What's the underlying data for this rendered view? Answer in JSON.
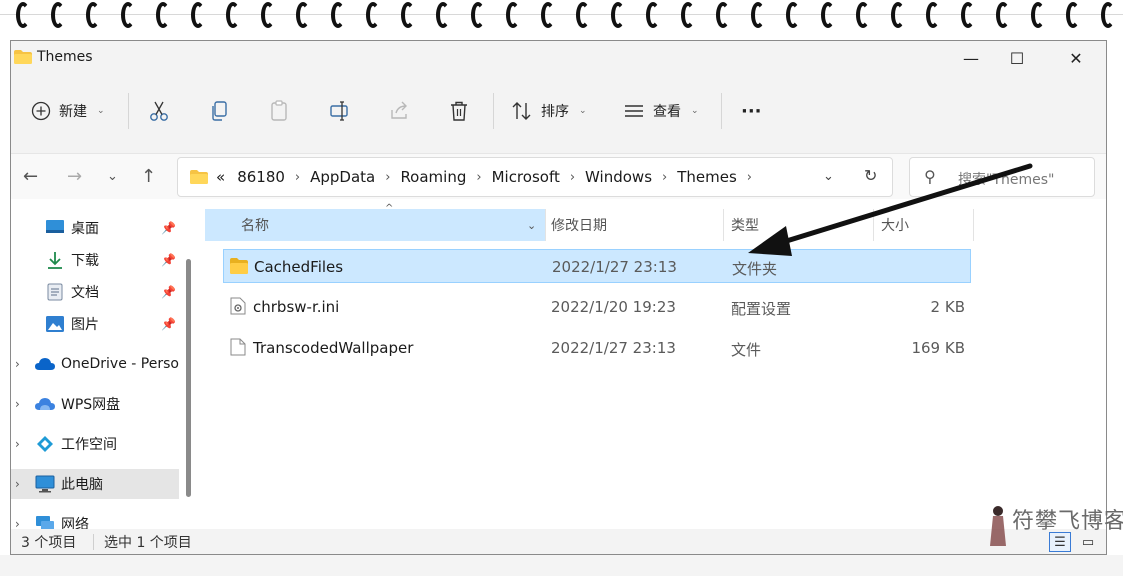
{
  "window": {
    "title": "Themes",
    "controls": {
      "minimize": "—",
      "maximize": "☐",
      "close": "✕"
    }
  },
  "toolbar": {
    "new_label": "新建",
    "sort_label": "排序",
    "view_label": "查看",
    "more_label": "···"
  },
  "address": {
    "overflow": "«",
    "crumbs": [
      "86180",
      "AppData",
      "Roaming",
      "Microsoft",
      "Windows",
      "Themes"
    ],
    "search_placeholder": "搜索\"Themes\""
  },
  "sidebar": {
    "quick": [
      {
        "label": "桌面",
        "icon": "desktop-icon"
      },
      {
        "label": "下载",
        "icon": "download-icon"
      },
      {
        "label": "文档",
        "icon": "document-icon"
      },
      {
        "label": "图片",
        "icon": "pictures-icon"
      }
    ],
    "groups": [
      {
        "label": "OneDrive - Personal",
        "icon": "onedrive-icon"
      },
      {
        "label": "WPS网盘",
        "icon": "wps-cloud-icon"
      },
      {
        "label": "工作空间",
        "icon": "workspace-icon"
      },
      {
        "label": "此电脑",
        "icon": "this-pc-icon"
      },
      {
        "label": "网络",
        "icon": "network-icon"
      }
    ]
  },
  "columns": {
    "name": "名称",
    "date": "修改日期",
    "type": "类型",
    "size": "大小"
  },
  "files": [
    {
      "name": "CachedFiles",
      "date": "2022/1/27 23:13",
      "type": "文件夹",
      "size": ""
    },
    {
      "name": "chrbsw-r.ini",
      "date": "2022/1/20 19:23",
      "type": "配置设置",
      "size": "2 KB"
    },
    {
      "name": "TranscodedWallpaper",
      "date": "2022/1/27 23:13",
      "type": "文件",
      "size": "169 KB"
    }
  ],
  "status": {
    "count": "3 个项目",
    "selected": "选中 1 个项目"
  },
  "watermark": "符攀飞博客",
  "colors": {
    "accent": "#0067c0",
    "selection": "#cce8ff",
    "folder": "#f6c344",
    "arrow": "#111111"
  }
}
